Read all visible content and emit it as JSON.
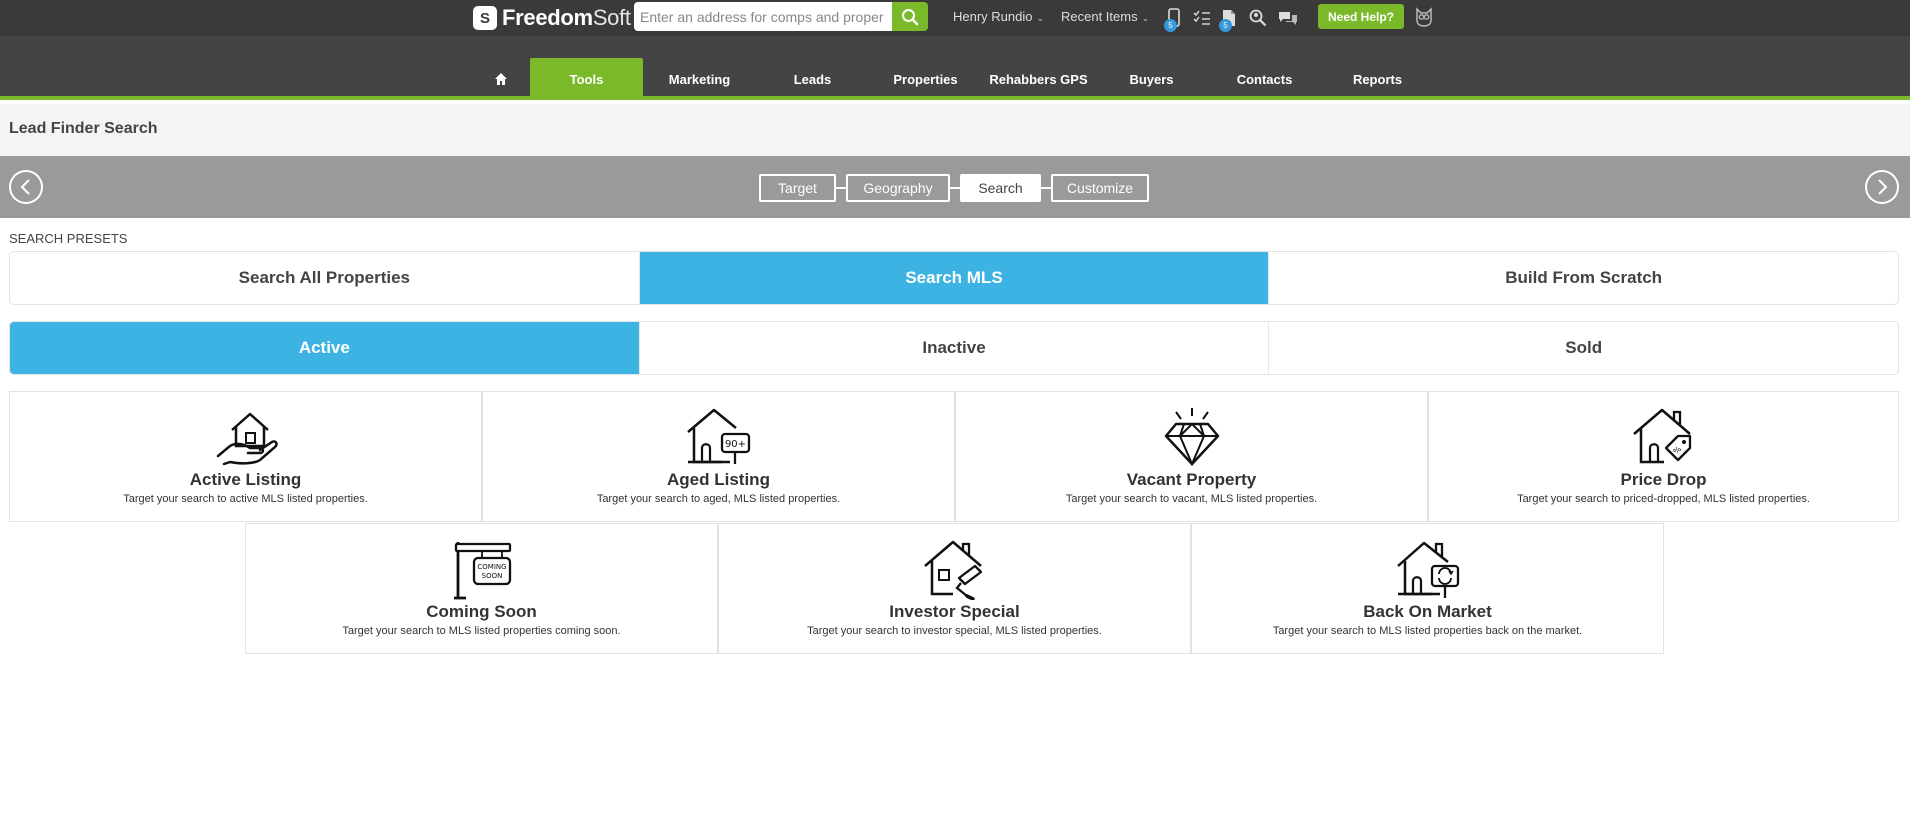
{
  "header": {
    "logo_mark": "S",
    "logo_bold": "Freedom",
    "logo_rest": "Soft",
    "search_placeholder": "Enter an address for comps and proper",
    "user_name": "Henry Rundio",
    "recent_items": "Recent Items",
    "badge_phone": "5",
    "badge_doc": "5",
    "help_label": "Need Help?"
  },
  "nav": {
    "items": [
      "Tools",
      "Marketing",
      "Leads",
      "Properties",
      "Rehabbers GPS",
      "Buyers",
      "Contacts",
      "Reports"
    ],
    "active": "Tools"
  },
  "page": {
    "title": "Lead Finder Search"
  },
  "wizard": {
    "steps": [
      "Target",
      "Geography",
      "Search",
      "Customize"
    ],
    "active": "Search"
  },
  "presets": {
    "label": "SEARCH PRESETS",
    "primary_tabs": [
      "Search All Properties",
      "Search MLS",
      "Build From Scratch"
    ],
    "primary_active": "Search MLS",
    "status_tabs": [
      "Active",
      "Inactive",
      "Sold"
    ],
    "status_active": "Active"
  },
  "cards": [
    {
      "title": "Active Listing",
      "desc": "Target your search to active MLS listed properties.",
      "icon": "house-in-hand-icon"
    },
    {
      "title": "Aged Listing",
      "desc": "Target your search to aged, MLS listed properties.",
      "icon": "house-90-plus-icon"
    },
    {
      "title": "Vacant Property",
      "desc": "Target your search to vacant, MLS listed properties.",
      "icon": "diamond-icon"
    },
    {
      "title": "Price Drop",
      "desc": "Target your search to priced-dropped, MLS listed properties.",
      "icon": "house-price-tag-icon"
    },
    {
      "title": "Coming Soon",
      "desc": "Target your search to MLS listed properties coming soon.",
      "icon": "coming-soon-sign-icon"
    },
    {
      "title": "Investor Special",
      "desc": "Target your search to investor special, MLS listed properties.",
      "icon": "house-paint-roller-icon"
    },
    {
      "title": "Back On Market",
      "desc": "Target your search to MLS listed properties back on the market.",
      "icon": "house-refresh-sign-icon"
    }
  ],
  "icon_text": {
    "aged": "90+",
    "coming_line1": "COMING",
    "coming_line2": "SOON"
  },
  "colors": {
    "brand_green": "#7ab929",
    "active_blue": "#3db3e3",
    "header_dark": "#3a3a3a",
    "badge_blue": "#3498db"
  }
}
